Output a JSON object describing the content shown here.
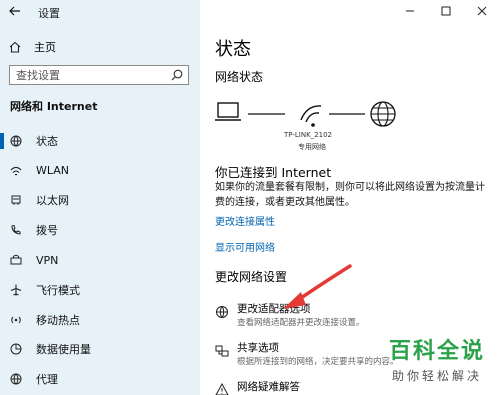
{
  "app_title": "设置",
  "home_label": "主页",
  "search_placeholder": "查找设置",
  "section_title": "网络和 Internet",
  "nav_items": [
    {
      "label": "状态",
      "icon": "home-globe-icon"
    },
    {
      "label": "WLAN",
      "icon": "wifi-icon"
    },
    {
      "label": "以太网",
      "icon": "ethernet-icon"
    },
    {
      "label": "拨号",
      "icon": "dialup-icon"
    },
    {
      "label": "VPN",
      "icon": "vpn-icon"
    },
    {
      "label": "飞行模式",
      "icon": "airplane-icon"
    },
    {
      "label": "移动热点",
      "icon": "hotspot-icon"
    },
    {
      "label": "数据使用量",
      "icon": "data-usage-icon"
    },
    {
      "label": "代理",
      "icon": "proxy-icon"
    }
  ],
  "main": {
    "title": "状态",
    "network_status_heading": "网络状态",
    "network_name": "TP-LINK_2102",
    "network_type": "专用网络",
    "connected_text": "你已连接到 Internet",
    "description": "如果你的流量套餐有限制，则你可以将此网络设置为按流量计费的连接，或者更改其他属性。",
    "link_change_properties": "更改连接属性",
    "link_show_networks": "显示可用网络",
    "change_heading": "更改网络设置",
    "options": [
      {
        "title": "更改适配器选项",
        "desc": "查看网络适配器并更改连接设置。",
        "icon": "adapter-icon"
      },
      {
        "title": "共享选项",
        "desc": "根据所连接到的网络，决定要共享的内容。",
        "icon": "sharing-icon"
      },
      {
        "title": "网络疑难解答",
        "desc": "",
        "icon": "troubleshoot-icon"
      }
    ]
  },
  "watermark": {
    "title": "百科全说",
    "subtitle": "助你轻松解决"
  },
  "colors": {
    "accent": "#0063b1",
    "sidebar_bg": "#e6f2f8",
    "annotation": "#e53935",
    "watermark": "#2aa24a"
  }
}
